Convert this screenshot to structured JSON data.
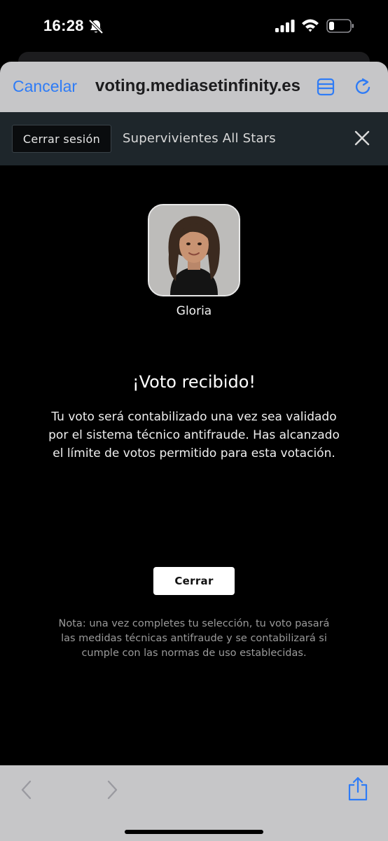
{
  "status_bar": {
    "time": "16:28",
    "icons": [
      "bell-slash-icon",
      "signal-icon",
      "wifi-icon",
      "battery-icon"
    ]
  },
  "browser": {
    "cancel_label": "Cancelar",
    "url": "voting.mediasetinfinity.es",
    "icons": [
      "reader-icon",
      "reload-icon"
    ],
    "accent_color": "#2f7cf6"
  },
  "header": {
    "logout_label": "Cerrar sesión",
    "program_title": "Supervivientes All Stars"
  },
  "contestant": {
    "name": "Gloria"
  },
  "result": {
    "title": "¡Voto recibido!",
    "message": "Tu voto será contabilizado una vez sea validado por el sistema técnico antifraude. Has alcanzado el límite de votos permitido para esta votación."
  },
  "close_label": "Cerrar",
  "footnote": "Nota: una vez completes tu selección, tu voto pasará las medidas técnicas antifraude y se contabilizará si cumple con las normas de uso establecidas.",
  "toolbar": {
    "icons": [
      "back-icon",
      "forward-icon",
      "share-icon"
    ]
  }
}
